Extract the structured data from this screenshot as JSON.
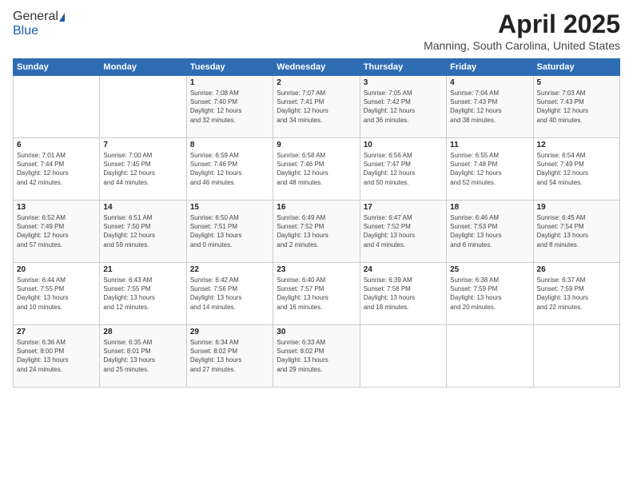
{
  "logo": {
    "general": "General",
    "blue": "Blue"
  },
  "header": {
    "month": "April 2025",
    "location": "Manning, South Carolina, United States"
  },
  "days_of_week": [
    "Sunday",
    "Monday",
    "Tuesday",
    "Wednesday",
    "Thursday",
    "Friday",
    "Saturday"
  ],
  "weeks": [
    [
      {
        "day": "",
        "info": ""
      },
      {
        "day": "",
        "info": ""
      },
      {
        "day": "1",
        "info": "Sunrise: 7:08 AM\nSunset: 7:40 PM\nDaylight: 12 hours\nand 32 minutes."
      },
      {
        "day": "2",
        "info": "Sunrise: 7:07 AM\nSunset: 7:41 PM\nDaylight: 12 hours\nand 34 minutes."
      },
      {
        "day": "3",
        "info": "Sunrise: 7:05 AM\nSunset: 7:42 PM\nDaylight: 12 hours\nand 36 minutes."
      },
      {
        "day": "4",
        "info": "Sunrise: 7:04 AM\nSunset: 7:43 PM\nDaylight: 12 hours\nand 38 minutes."
      },
      {
        "day": "5",
        "info": "Sunrise: 7:03 AM\nSunset: 7:43 PM\nDaylight: 12 hours\nand 40 minutes."
      }
    ],
    [
      {
        "day": "6",
        "info": "Sunrise: 7:01 AM\nSunset: 7:44 PM\nDaylight: 12 hours\nand 42 minutes."
      },
      {
        "day": "7",
        "info": "Sunrise: 7:00 AM\nSunset: 7:45 PM\nDaylight: 12 hours\nand 44 minutes."
      },
      {
        "day": "8",
        "info": "Sunrise: 6:59 AM\nSunset: 7:46 PM\nDaylight: 12 hours\nand 46 minutes."
      },
      {
        "day": "9",
        "info": "Sunrise: 6:58 AM\nSunset: 7:46 PM\nDaylight: 12 hours\nand 48 minutes."
      },
      {
        "day": "10",
        "info": "Sunrise: 6:56 AM\nSunset: 7:47 PM\nDaylight: 12 hours\nand 50 minutes."
      },
      {
        "day": "11",
        "info": "Sunrise: 6:55 AM\nSunset: 7:48 PM\nDaylight: 12 hours\nand 52 minutes."
      },
      {
        "day": "12",
        "info": "Sunrise: 6:54 AM\nSunset: 7:49 PM\nDaylight: 12 hours\nand 54 minutes."
      }
    ],
    [
      {
        "day": "13",
        "info": "Sunrise: 6:52 AM\nSunset: 7:49 PM\nDaylight: 12 hours\nand 57 minutes."
      },
      {
        "day": "14",
        "info": "Sunrise: 6:51 AM\nSunset: 7:50 PM\nDaylight: 12 hours\nand 59 minutes."
      },
      {
        "day": "15",
        "info": "Sunrise: 6:50 AM\nSunset: 7:51 PM\nDaylight: 13 hours\nand 0 minutes."
      },
      {
        "day": "16",
        "info": "Sunrise: 6:49 AM\nSunset: 7:52 PM\nDaylight: 13 hours\nand 2 minutes."
      },
      {
        "day": "17",
        "info": "Sunrise: 6:47 AM\nSunset: 7:52 PM\nDaylight: 13 hours\nand 4 minutes."
      },
      {
        "day": "18",
        "info": "Sunrise: 6:46 AM\nSunset: 7:53 PM\nDaylight: 13 hours\nand 6 minutes."
      },
      {
        "day": "19",
        "info": "Sunrise: 6:45 AM\nSunset: 7:54 PM\nDaylight: 13 hours\nand 8 minutes."
      }
    ],
    [
      {
        "day": "20",
        "info": "Sunrise: 6:44 AM\nSunset: 7:55 PM\nDaylight: 13 hours\nand 10 minutes."
      },
      {
        "day": "21",
        "info": "Sunrise: 6:43 AM\nSunset: 7:55 PM\nDaylight: 13 hours\nand 12 minutes."
      },
      {
        "day": "22",
        "info": "Sunrise: 6:42 AM\nSunset: 7:56 PM\nDaylight: 13 hours\nand 14 minutes."
      },
      {
        "day": "23",
        "info": "Sunrise: 6:40 AM\nSunset: 7:57 PM\nDaylight: 13 hours\nand 16 minutes."
      },
      {
        "day": "24",
        "info": "Sunrise: 6:39 AM\nSunset: 7:58 PM\nDaylight: 13 hours\nand 18 minutes."
      },
      {
        "day": "25",
        "info": "Sunrise: 6:38 AM\nSunset: 7:59 PM\nDaylight: 13 hours\nand 20 minutes."
      },
      {
        "day": "26",
        "info": "Sunrise: 6:37 AM\nSunset: 7:59 PM\nDaylight: 13 hours\nand 22 minutes."
      }
    ],
    [
      {
        "day": "27",
        "info": "Sunrise: 6:36 AM\nSunset: 8:00 PM\nDaylight: 13 hours\nand 24 minutes."
      },
      {
        "day": "28",
        "info": "Sunrise: 6:35 AM\nSunset: 8:01 PM\nDaylight: 13 hours\nand 25 minutes."
      },
      {
        "day": "29",
        "info": "Sunrise: 6:34 AM\nSunset: 8:02 PM\nDaylight: 13 hours\nand 27 minutes."
      },
      {
        "day": "30",
        "info": "Sunrise: 6:33 AM\nSunset: 8:02 PM\nDaylight: 13 hours\nand 29 minutes."
      },
      {
        "day": "",
        "info": ""
      },
      {
        "day": "",
        "info": ""
      },
      {
        "day": "",
        "info": ""
      }
    ]
  ]
}
